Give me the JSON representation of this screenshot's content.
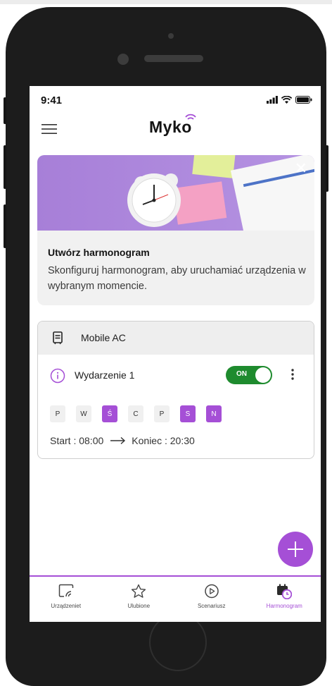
{
  "status_bar": {
    "time": "9:41"
  },
  "header": {
    "app_name": "Myko"
  },
  "banner": {
    "title": "Utwórz harmonogram",
    "description": "Skonfiguruj harmonogram, aby uruchamiać urządzenia w wybranym momencie.",
    "close_icon": "close-icon"
  },
  "device": {
    "name": "Mobile AC",
    "icon": "ac-unit-icon"
  },
  "event": {
    "name": "Wydarzenie 1",
    "toggle_label": "ON",
    "enabled": true,
    "days": [
      {
        "label": "P",
        "active": false
      },
      {
        "label": "W",
        "active": false
      },
      {
        "label": "Ś",
        "active": true
      },
      {
        "label": "C",
        "active": false
      },
      {
        "label": "P",
        "active": false
      },
      {
        "label": "S",
        "active": true
      },
      {
        "label": "N",
        "active": true
      }
    ],
    "start_label": "Start : 08:00",
    "end_label": "Koniec : 20:30"
  },
  "fab": {
    "icon": "plus-icon"
  },
  "bottom_nav": {
    "items": [
      {
        "label": "Urządzeniet",
        "icon": "devices-icon",
        "active": false
      },
      {
        "label": "Ulubione",
        "icon": "star-icon",
        "active": false
      },
      {
        "label": "Scenariusz",
        "icon": "play-icon",
        "active": false
      },
      {
        "label": "Harmonogram",
        "icon": "calendar-clock-icon",
        "active": true
      }
    ]
  },
  "colors": {
    "accent": "#a54fd6",
    "toggle_on": "#1e8b2e"
  }
}
